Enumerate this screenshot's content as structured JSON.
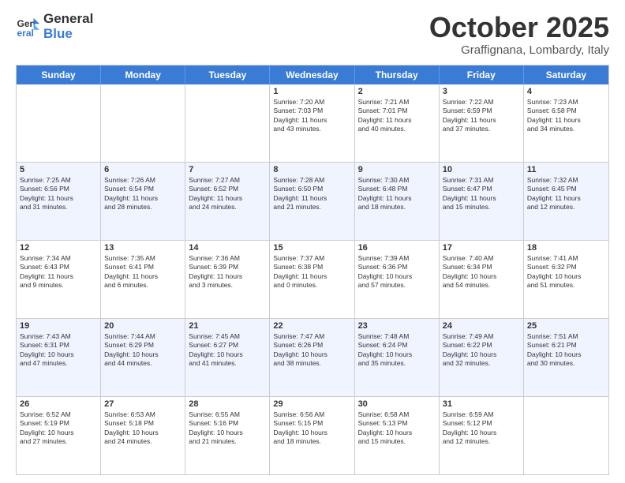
{
  "logo": {
    "line1": "General",
    "line2": "Blue"
  },
  "title": "October 2025",
  "subtitle": "Graffignana, Lombardy, Italy",
  "header_days": [
    "Sunday",
    "Monday",
    "Tuesday",
    "Wednesday",
    "Thursday",
    "Friday",
    "Saturday"
  ],
  "rows": [
    {
      "alt": false,
      "cells": [
        {
          "day": "",
          "info": ""
        },
        {
          "day": "",
          "info": ""
        },
        {
          "day": "",
          "info": ""
        },
        {
          "day": "1",
          "info": "Sunrise: 7:20 AM\nSunset: 7:03 PM\nDaylight: 11 hours\nand 43 minutes."
        },
        {
          "day": "2",
          "info": "Sunrise: 7:21 AM\nSunset: 7:01 PM\nDaylight: 11 hours\nand 40 minutes."
        },
        {
          "day": "3",
          "info": "Sunrise: 7:22 AM\nSunset: 6:59 PM\nDaylight: 11 hours\nand 37 minutes."
        },
        {
          "day": "4",
          "info": "Sunrise: 7:23 AM\nSunset: 6:58 PM\nDaylight: 11 hours\nand 34 minutes."
        }
      ]
    },
    {
      "alt": true,
      "cells": [
        {
          "day": "5",
          "info": "Sunrise: 7:25 AM\nSunset: 6:56 PM\nDaylight: 11 hours\nand 31 minutes."
        },
        {
          "day": "6",
          "info": "Sunrise: 7:26 AM\nSunset: 6:54 PM\nDaylight: 11 hours\nand 28 minutes."
        },
        {
          "day": "7",
          "info": "Sunrise: 7:27 AM\nSunset: 6:52 PM\nDaylight: 11 hours\nand 24 minutes."
        },
        {
          "day": "8",
          "info": "Sunrise: 7:28 AM\nSunset: 6:50 PM\nDaylight: 11 hours\nand 21 minutes."
        },
        {
          "day": "9",
          "info": "Sunrise: 7:30 AM\nSunset: 6:48 PM\nDaylight: 11 hours\nand 18 minutes."
        },
        {
          "day": "10",
          "info": "Sunrise: 7:31 AM\nSunset: 6:47 PM\nDaylight: 11 hours\nand 15 minutes."
        },
        {
          "day": "11",
          "info": "Sunrise: 7:32 AM\nSunset: 6:45 PM\nDaylight: 11 hours\nand 12 minutes."
        }
      ]
    },
    {
      "alt": false,
      "cells": [
        {
          "day": "12",
          "info": "Sunrise: 7:34 AM\nSunset: 6:43 PM\nDaylight: 11 hours\nand 9 minutes."
        },
        {
          "day": "13",
          "info": "Sunrise: 7:35 AM\nSunset: 6:41 PM\nDaylight: 11 hours\nand 6 minutes."
        },
        {
          "day": "14",
          "info": "Sunrise: 7:36 AM\nSunset: 6:39 PM\nDaylight: 11 hours\nand 3 minutes."
        },
        {
          "day": "15",
          "info": "Sunrise: 7:37 AM\nSunset: 6:38 PM\nDaylight: 11 hours\nand 0 minutes."
        },
        {
          "day": "16",
          "info": "Sunrise: 7:39 AM\nSunset: 6:36 PM\nDaylight: 10 hours\nand 57 minutes."
        },
        {
          "day": "17",
          "info": "Sunrise: 7:40 AM\nSunset: 6:34 PM\nDaylight: 10 hours\nand 54 minutes."
        },
        {
          "day": "18",
          "info": "Sunrise: 7:41 AM\nSunset: 6:32 PM\nDaylight: 10 hours\nand 51 minutes."
        }
      ]
    },
    {
      "alt": true,
      "cells": [
        {
          "day": "19",
          "info": "Sunrise: 7:43 AM\nSunset: 6:31 PM\nDaylight: 10 hours\nand 47 minutes."
        },
        {
          "day": "20",
          "info": "Sunrise: 7:44 AM\nSunset: 6:29 PM\nDaylight: 10 hours\nand 44 minutes."
        },
        {
          "day": "21",
          "info": "Sunrise: 7:45 AM\nSunset: 6:27 PM\nDaylight: 10 hours\nand 41 minutes."
        },
        {
          "day": "22",
          "info": "Sunrise: 7:47 AM\nSunset: 6:26 PM\nDaylight: 10 hours\nand 38 minutes."
        },
        {
          "day": "23",
          "info": "Sunrise: 7:48 AM\nSunset: 6:24 PM\nDaylight: 10 hours\nand 35 minutes."
        },
        {
          "day": "24",
          "info": "Sunrise: 7:49 AM\nSunset: 6:22 PM\nDaylight: 10 hours\nand 32 minutes."
        },
        {
          "day": "25",
          "info": "Sunrise: 7:51 AM\nSunset: 6:21 PM\nDaylight: 10 hours\nand 30 minutes."
        }
      ]
    },
    {
      "alt": false,
      "cells": [
        {
          "day": "26",
          "info": "Sunrise: 6:52 AM\nSunset: 5:19 PM\nDaylight: 10 hours\nand 27 minutes."
        },
        {
          "day": "27",
          "info": "Sunrise: 6:53 AM\nSunset: 5:18 PM\nDaylight: 10 hours\nand 24 minutes."
        },
        {
          "day": "28",
          "info": "Sunrise: 6:55 AM\nSunset: 5:16 PM\nDaylight: 10 hours\nand 21 minutes."
        },
        {
          "day": "29",
          "info": "Sunrise: 6:56 AM\nSunset: 5:15 PM\nDaylight: 10 hours\nand 18 minutes."
        },
        {
          "day": "30",
          "info": "Sunrise: 6:58 AM\nSunset: 5:13 PM\nDaylight: 10 hours\nand 15 minutes."
        },
        {
          "day": "31",
          "info": "Sunrise: 6:59 AM\nSunset: 5:12 PM\nDaylight: 10 hours\nand 12 minutes."
        },
        {
          "day": "",
          "info": ""
        }
      ]
    }
  ]
}
